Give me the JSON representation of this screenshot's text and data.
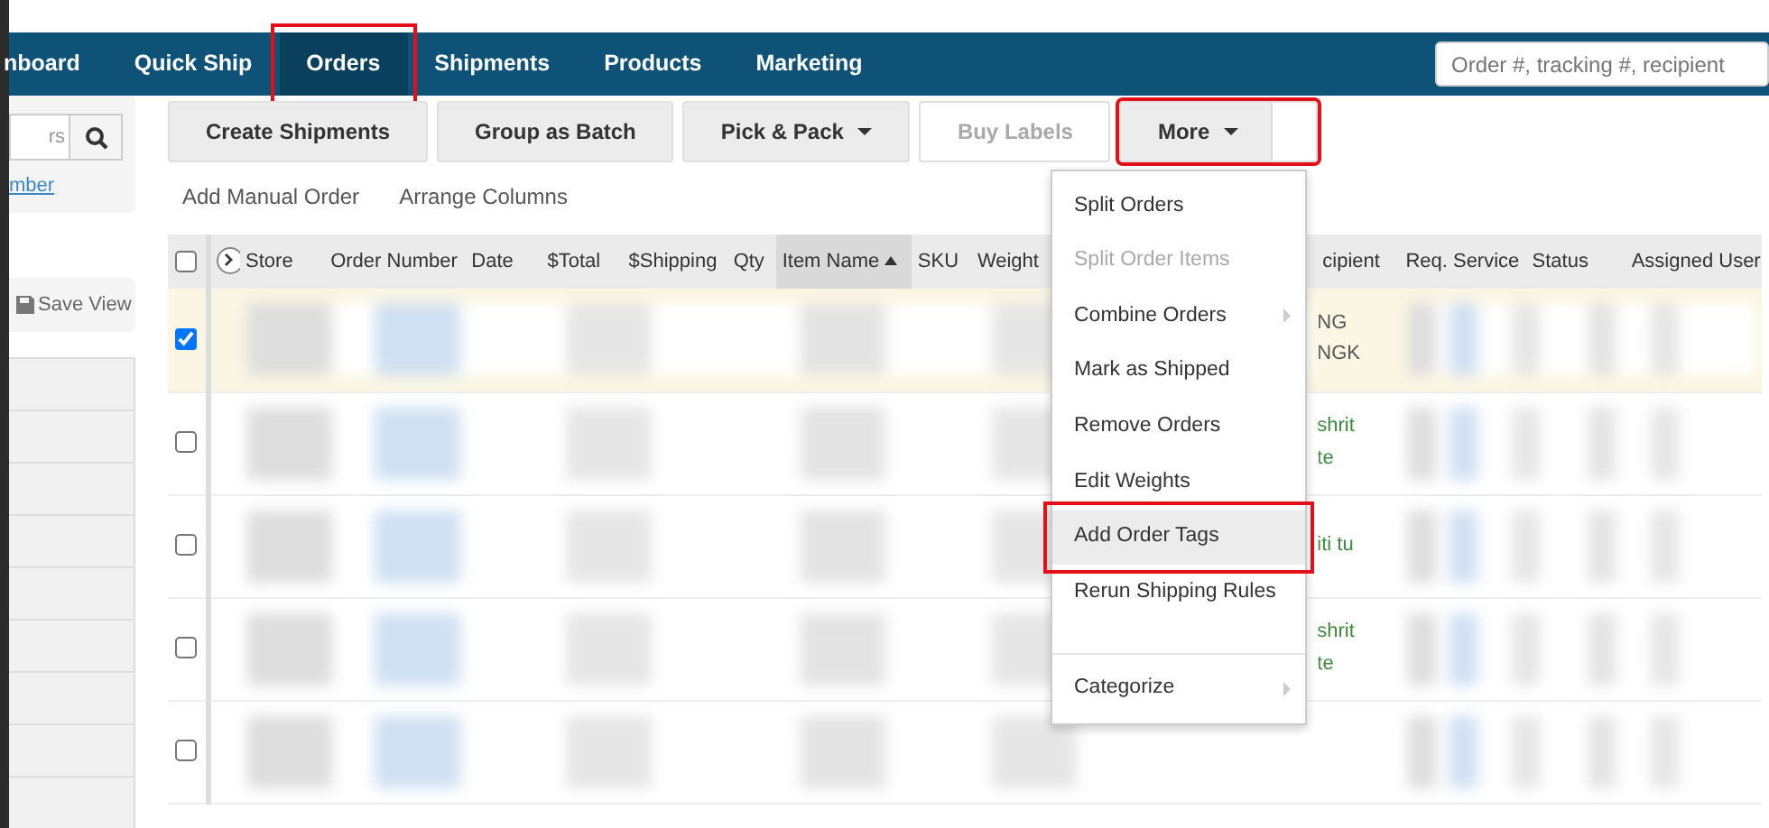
{
  "nav": {
    "tabs": [
      {
        "label": "nboard",
        "selected": false,
        "highlighted": false
      },
      {
        "label": "Quick Ship",
        "selected": false,
        "highlighted": false
      },
      {
        "label": "Orders",
        "selected": true,
        "highlighted": true
      },
      {
        "label": "Shipments",
        "selected": false,
        "highlighted": false
      },
      {
        "label": "Products",
        "selected": false,
        "highlighted": false
      },
      {
        "label": "Marketing",
        "selected": false,
        "highlighted": false
      }
    ],
    "search": {
      "placeholder": "Order #, tracking #, recipient"
    }
  },
  "sidebar": {
    "search": {
      "value": "rs"
    },
    "link": "mber",
    "save_view": "Save View"
  },
  "toolbar": {
    "buttons": [
      {
        "label": "Create Shipments",
        "kind": "plain",
        "disabled": false,
        "highlighted": false
      },
      {
        "label": "Group as Batch",
        "kind": "plain",
        "disabled": false,
        "highlighted": false
      },
      {
        "label": "Pick & Pack",
        "kind": "dropdown",
        "disabled": false,
        "highlighted": false
      },
      {
        "label": "Buy Labels",
        "kind": "plain",
        "disabled": true,
        "highlighted": false
      },
      {
        "label": "More",
        "kind": "split",
        "disabled": false,
        "highlighted": true
      }
    ],
    "links": [
      "Add Manual Order",
      "Arrange Columns"
    ]
  },
  "table": {
    "select_all_checked": false,
    "columns": [
      {
        "label": "Store",
        "sorted": false
      },
      {
        "label": "Order Number",
        "sorted": false
      },
      {
        "label": "Date",
        "sorted": false
      },
      {
        "label": "$Total",
        "sorted": false
      },
      {
        "label": "$Shipping",
        "sorted": false
      },
      {
        "label": "Qty",
        "sorted": false
      },
      {
        "label": "Item Name",
        "sorted": true
      },
      {
        "label": "SKU",
        "sorted": false
      },
      {
        "label": "Weight",
        "sorted": false
      },
      {
        "label": "cipient",
        "sorted": false
      },
      {
        "label": "Req. Service",
        "sorted": false
      },
      {
        "label": "Status",
        "sorted": false
      },
      {
        "label": "Assigned User",
        "sorted": false
      }
    ],
    "rows": [
      {
        "selected": true,
        "recipient": [
          "NG",
          "NGK"
        ]
      },
      {
        "selected": false,
        "recipient": [
          "shrit",
          "te"
        ]
      },
      {
        "selected": false,
        "recipient": [
          "iti tu"
        ]
      },
      {
        "selected": false,
        "recipient": [
          "shrit",
          "te"
        ]
      },
      {
        "selected": false,
        "recipient": []
      }
    ]
  },
  "menu": {
    "items": [
      {
        "label": "Split Orders",
        "disabled": false,
        "submenu": false,
        "highlighted": false
      },
      {
        "label": "Split Order Items",
        "disabled": true,
        "submenu": false,
        "highlighted": false
      },
      {
        "label": "Combine Orders",
        "disabled": false,
        "submenu": true,
        "highlighted": false
      },
      {
        "label": "Mark as Shipped",
        "disabled": false,
        "submenu": false,
        "highlighted": false
      },
      {
        "label": "Remove Orders",
        "disabled": false,
        "submenu": false,
        "highlighted": false
      },
      {
        "label": "Edit Weights",
        "disabled": false,
        "submenu": false,
        "highlighted": false
      },
      {
        "label": "Add Order Tags",
        "disabled": false,
        "submenu": false,
        "highlighted": true
      },
      {
        "label": "Rerun Shipping Rules",
        "disabled": false,
        "submenu": false,
        "highlighted": false
      },
      {
        "label": "Categorize",
        "disabled": false,
        "submenu": true,
        "highlighted": false,
        "divider_before": true
      }
    ]
  }
}
